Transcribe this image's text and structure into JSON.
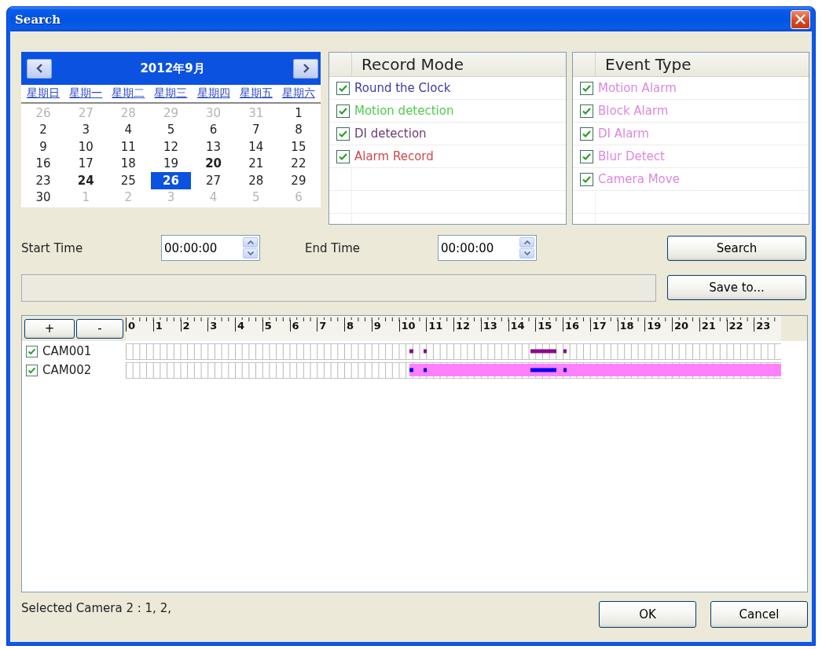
{
  "window": {
    "title": "Search"
  },
  "calendar": {
    "month_title": "2012年9月",
    "weekdays": [
      "星期日",
      "星期一",
      "星期二",
      "星期三",
      "星期四",
      "星期五",
      "星期六"
    ],
    "weeks": [
      [
        {
          "day": "26",
          "other_month": true,
          "marked": false,
          "selected": false
        },
        {
          "day": "27",
          "other_month": true,
          "marked": false,
          "selected": false
        },
        {
          "day": "28",
          "other_month": true,
          "marked": false,
          "selected": false
        },
        {
          "day": "29",
          "other_month": true,
          "marked": false,
          "selected": false
        },
        {
          "day": "30",
          "other_month": true,
          "marked": false,
          "selected": false
        },
        {
          "day": "31",
          "other_month": true,
          "marked": false,
          "selected": false
        },
        {
          "day": "1",
          "other_month": false,
          "marked": false,
          "selected": false
        }
      ],
      [
        {
          "day": "2",
          "other_month": false,
          "marked": false,
          "selected": false
        },
        {
          "day": "3",
          "other_month": false,
          "marked": false,
          "selected": false
        },
        {
          "day": "4",
          "other_month": false,
          "marked": false,
          "selected": false
        },
        {
          "day": "5",
          "other_month": false,
          "marked": false,
          "selected": false
        },
        {
          "day": "6",
          "other_month": false,
          "marked": false,
          "selected": false
        },
        {
          "day": "7",
          "other_month": false,
          "marked": false,
          "selected": false
        },
        {
          "day": "8",
          "other_month": false,
          "marked": false,
          "selected": false
        }
      ],
      [
        {
          "day": "9",
          "other_month": false,
          "marked": false,
          "selected": false
        },
        {
          "day": "10",
          "other_month": false,
          "marked": false,
          "selected": false
        },
        {
          "day": "11",
          "other_month": false,
          "marked": false,
          "selected": false
        },
        {
          "day": "12",
          "other_month": false,
          "marked": false,
          "selected": false
        },
        {
          "day": "13",
          "other_month": false,
          "marked": false,
          "selected": false
        },
        {
          "day": "14",
          "other_month": false,
          "marked": false,
          "selected": false
        },
        {
          "day": "15",
          "other_month": false,
          "marked": false,
          "selected": false
        }
      ],
      [
        {
          "day": "16",
          "other_month": false,
          "marked": false,
          "selected": false
        },
        {
          "day": "17",
          "other_month": false,
          "marked": false,
          "selected": false
        },
        {
          "day": "18",
          "other_month": false,
          "marked": false,
          "selected": false
        },
        {
          "day": "19",
          "other_month": false,
          "marked": false,
          "selected": false
        },
        {
          "day": "20",
          "other_month": false,
          "marked": true,
          "selected": false
        },
        {
          "day": "21",
          "other_month": false,
          "marked": false,
          "selected": false
        },
        {
          "day": "22",
          "other_month": false,
          "marked": false,
          "selected": false
        }
      ],
      [
        {
          "day": "23",
          "other_month": false,
          "marked": false,
          "selected": false
        },
        {
          "day": "24",
          "other_month": false,
          "marked": true,
          "selected": false
        },
        {
          "day": "25",
          "other_month": false,
          "marked": false,
          "selected": false
        },
        {
          "day": "26",
          "other_month": false,
          "marked": false,
          "selected": true
        },
        {
          "day": "27",
          "other_month": false,
          "marked": false,
          "selected": false
        },
        {
          "day": "28",
          "other_month": false,
          "marked": false,
          "selected": false
        },
        {
          "day": "29",
          "other_month": false,
          "marked": false,
          "selected": false
        }
      ],
      [
        {
          "day": "30",
          "other_month": false,
          "marked": false,
          "selected": false
        },
        {
          "day": "1",
          "other_month": true,
          "marked": false,
          "selected": false
        },
        {
          "day": "2",
          "other_month": true,
          "marked": false,
          "selected": false
        },
        {
          "day": "3",
          "other_month": true,
          "marked": false,
          "selected": false
        },
        {
          "day": "4",
          "other_month": true,
          "marked": false,
          "selected": false
        },
        {
          "day": "5",
          "other_month": true,
          "marked": false,
          "selected": false
        },
        {
          "day": "6",
          "other_month": true,
          "marked": false,
          "selected": false
        }
      ]
    ]
  },
  "record_mode": {
    "header": "Record Mode",
    "items": [
      {
        "label": "Round the Clock",
        "checked": true,
        "color": "#3b3b9c"
      },
      {
        "label": "Motion detection",
        "checked": true,
        "color": "#4fcc4f"
      },
      {
        "label": "DI detection",
        "checked": true,
        "color": "#6e3a6e"
      },
      {
        "label": "Alarm Record",
        "checked": true,
        "color": "#d04848"
      }
    ]
  },
  "event_type": {
    "header": "Event Type",
    "items": [
      {
        "label": "Motion Alarm",
        "checked": true,
        "color": "#dd88dd"
      },
      {
        "label": "Block Alarm",
        "checked": true,
        "color": "#dd88dd"
      },
      {
        "label": "DI Alarm",
        "checked": true,
        "color": "#dd88dd"
      },
      {
        "label": "Blur Detect",
        "checked": true,
        "color": "#dd88dd"
      },
      {
        "label": "Camera Move",
        "checked": true,
        "color": "#dd88dd"
      }
    ]
  },
  "time": {
    "start": {
      "label": "Start Time",
      "value": "00:00:00"
    },
    "end": {
      "label": "End Time",
      "value": "00:00:00"
    }
  },
  "search_button": "Search",
  "save_button": "Save to...",
  "timeline": {
    "zoom_in": "+",
    "zoom_out": "-",
    "hours": [
      "0",
      "1",
      "2",
      "3",
      "4",
      "5",
      "6",
      "7",
      "8",
      "9",
      "10",
      "11",
      "12",
      "13",
      "14",
      "15",
      "16",
      "17",
      "18",
      "19",
      "20",
      "21",
      "22",
      "23"
    ],
    "cameras": [
      {
        "name": "CAM001",
        "checked": true
      },
      {
        "name": "CAM002",
        "checked": true
      }
    ]
  },
  "status_bar": {
    "text": "Selected Camera 2 : 1, 2,"
  },
  "dialog_buttons": [
    "OK",
    "Cancel"
  ]
}
